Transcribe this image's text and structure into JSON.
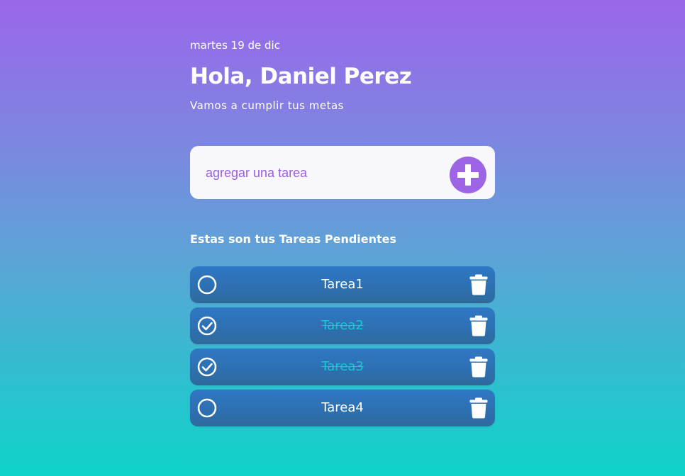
{
  "header": {
    "date": "martes 19 de dic",
    "greeting": "Hola, Daniel Perez",
    "subtitle": "Vamos a cumplir tus metas"
  },
  "new_task": {
    "placeholder": "agregar una tarea",
    "value": "",
    "add_icon": "plus-circle-icon"
  },
  "tasks_section": {
    "title": "Estas son tus Tareas Pendientes"
  },
  "tasks": [
    {
      "name": "Tarea1",
      "done": false
    },
    {
      "name": "Tarea2",
      "done": true
    },
    {
      "name": "Tarea3",
      "done": true
    },
    {
      "name": "Tarea4",
      "done": false
    }
  ],
  "icons": {
    "unchecked": "circle-icon",
    "checked": "check-circle-icon",
    "delete": "trash-icon"
  },
  "colors": {
    "gradient_top": "#9a67ea",
    "gradient_bottom": "#0dd3c8",
    "accent_purple": "#9d65e5",
    "task_bg": "#2d6fb0",
    "done_text": "#14c9cf"
  }
}
